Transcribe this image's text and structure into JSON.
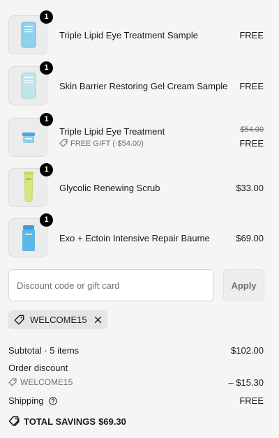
{
  "line_items": [
    {
      "name": "Triple Lipid Eye Treatment Sample",
      "quantity": "1",
      "price": "FREE"
    },
    {
      "name": "Skin Barrier Restoring Gel Cream Sample",
      "quantity": "1",
      "price": "FREE"
    },
    {
      "name": "Triple Lipid Eye Treatment",
      "quantity": "1",
      "price": "FREE",
      "original_price": "$54.00",
      "gift_label": "FREE GIFT (-$54.00)"
    },
    {
      "name": "Glycolic Renewing Scrub",
      "quantity": "1",
      "price": "$33.00"
    },
    {
      "name": "Exo + Ectoin Intensive Repair Baume",
      "quantity": "1",
      "price": "$69.00"
    }
  ],
  "discount": {
    "placeholder": "Discount code or gift card",
    "apply_label": "Apply",
    "applied_code": "WELCOME15"
  },
  "summary": {
    "subtotal_label": "Subtotal · 5 items",
    "subtotal_value": "$102.00",
    "order_discount_label": "Order discount",
    "order_discount_code": "WELCOME15",
    "order_discount_value": "– $15.30",
    "shipping_label": "Shipping",
    "shipping_value": "FREE",
    "total_savings_label": "TOTAL SAVINGS",
    "total_savings_value": "$69.30"
  },
  "icons": {
    "quantity_badge": "count-badge",
    "tag": "tag-icon",
    "remove": "close-icon",
    "help": "question-circle-icon",
    "savings": "double-tag-icon"
  },
  "colors": {
    "background": "#f5f5f5",
    "badge": "#000000",
    "muted_text": "#707070",
    "chip_background": "#e5e5e5",
    "product_blue": "#7cc4e6",
    "product_green": "#d3e87a"
  }
}
